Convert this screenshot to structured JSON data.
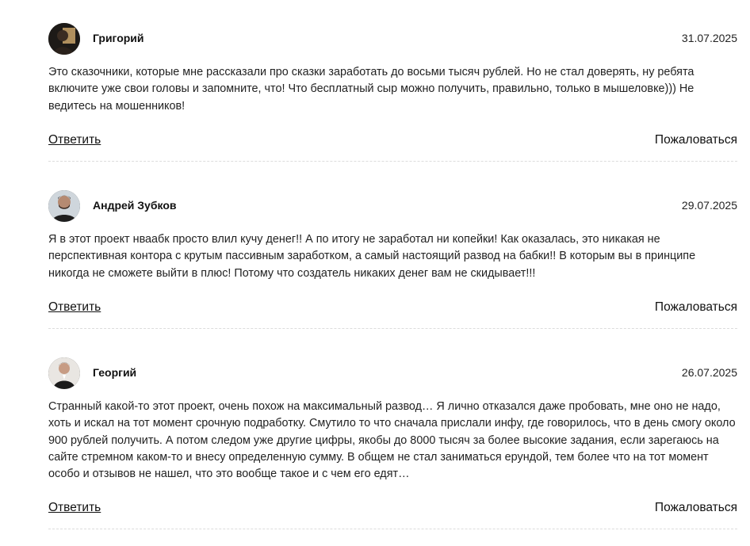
{
  "comments": [
    {
      "author": "Григорий",
      "date": "31.07.2025",
      "text": "Это сказочники, которые мне рассказали про сказки заработать до восьми тысяч рублей. Но не стал доверять, ну ребята включите уже свои головы и запомните, что! Что бесплатный сыр можно получить, правильно, только в мышеловке))) Не ведитесь на мошенников!",
      "reply_label": "Ответить",
      "report_label": "Пожаловаться"
    },
    {
      "author": "Андрей Зубков",
      "date": "29.07.2025",
      "text": "Я в этот проект нваабк просто влил кучу денег!! А по итогу не заработал ни копейки! Как оказалась, это никакая не перспективная контора с крутым пассивным заработком, а самый настоящий развод на бабки!! В которым вы в принципе никогда не сможете выйти в плюс! Потому что создатель никаких денег вам не скидывает!!!",
      "reply_label": "Ответить",
      "report_label": "Пожаловаться"
    },
    {
      "author": "Георгий",
      "date": "26.07.2025",
      "text": "Странный какой-то этот проект, очень похож на максимальный развод… Я лично отказался даже пробовать, мне оно не надо, хоть и искал на тот момент срочную подработку. Смутило то что сначала прислали инфу, где говорилось, что в день смогу около 900 рублей получить. А потом следом уже другие цифры, якобы до 8000 тысяч за более высокие задания, если зарегаюсь на сайте стремном каком-то и внесу определенную сумму. В общем не стал заниматься ерундой, тем более что на тот момент особо и отзывов не нашел, что это вообще такое и с чем его едят…",
      "reply_label": "Ответить",
      "report_label": "Пожаловаться"
    }
  ]
}
